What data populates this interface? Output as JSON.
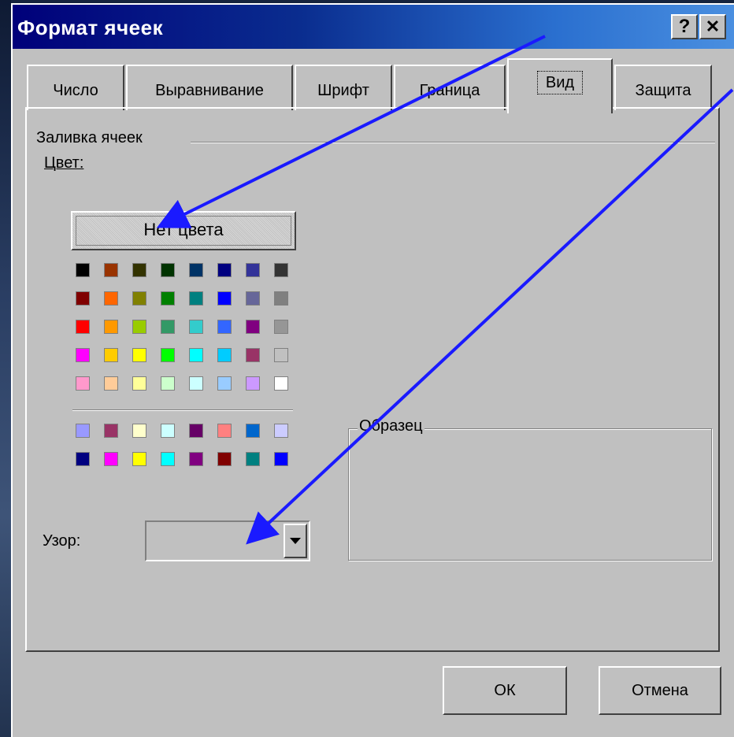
{
  "dialog": {
    "title": "Формат ячеек",
    "help_label": "?",
    "close_label": "✕"
  },
  "tabs": [
    {
      "label": "Число",
      "active": false
    },
    {
      "label": "Выравнивание",
      "active": false
    },
    {
      "label": "Шрифт",
      "active": false
    },
    {
      "label": "Граница",
      "active": false
    },
    {
      "label": "Вид",
      "active": true
    },
    {
      "label": "Защита",
      "active": false
    }
  ],
  "fill": {
    "group_label": "Заливка ячеек",
    "color_label": "Цвет:",
    "no_color_button": "Нет цвета",
    "palette": [
      [
        "#000000",
        "#993300",
        "#333300",
        "#003300",
        "#003366",
        "#000080",
        "#333399",
        "#333333"
      ],
      [
        "#800000",
        "#FF6600",
        "#808000",
        "#008000",
        "#008080",
        "#0000FF",
        "#666699",
        "#808080"
      ],
      [
        "#FF0000",
        "#FF9900",
        "#99CC00",
        "#339966",
        "#33CCCC",
        "#3366FF",
        "#800080",
        "#969696"
      ],
      [
        "#FF00FF",
        "#FFCC00",
        "#FFFF00",
        "#00FF00",
        "#00FFFF",
        "#00CCFF",
        "#993366",
        "#C0C0C0"
      ],
      [
        "#FF99CC",
        "#FFCC99",
        "#FFFF99",
        "#CCFFCC",
        "#CCFFFF",
        "#99CCFF",
        "#CC99FF",
        "#FFFFFF"
      ]
    ],
    "chart_palette": [
      [
        "#9999FF",
        "#993366",
        "#FFFFCC",
        "#CCFFFF",
        "#660066",
        "#FF8080",
        "#0066CC",
        "#CCCCFF"
      ],
      [
        "#000080",
        "#FF00FF",
        "#FFFF00",
        "#00FFFF",
        "#800080",
        "#800000",
        "#008080",
        "#0000FF"
      ]
    ]
  },
  "pattern": {
    "label": "Узор:",
    "value": ""
  },
  "sample": {
    "label": "Образец"
  },
  "buttons": {
    "ok": "ОК",
    "cancel": "Отмена"
  },
  "colors": {
    "arrow": "#1a1aff",
    "titlebar_start": "#00007a",
    "titlebar_end": "#4a8fe0",
    "dialog_face": "#c0c0c0"
  }
}
